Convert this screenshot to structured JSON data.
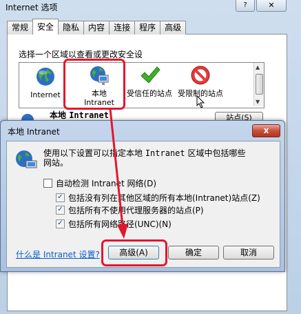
{
  "outer": {
    "title": "Internet 选项",
    "help_label": "?",
    "close_label": "✕",
    "tabs": [
      {
        "label": "常规"
      },
      {
        "label": "安全"
      },
      {
        "label": "隐私"
      },
      {
        "label": "内容"
      },
      {
        "label": "连接"
      },
      {
        "label": "程序"
      },
      {
        "label": "高级"
      }
    ],
    "zone_prompt": "选择一个区域以查看或更改安全设",
    "zones": [
      {
        "label": "Internet",
        "icon": "globe-icon"
      },
      {
        "label_line1": "本地",
        "label_line2": "Intranet",
        "icon": "intranet-icon"
      },
      {
        "label": "受信任的站点",
        "icon": "check-icon"
      },
      {
        "label": "受限制的站点",
        "icon": "restricted-icon"
      }
    ],
    "zone_heading_cn": "本地 ",
    "zone_heading_en": "Intranet",
    "sites_button": "站点(S)"
  },
  "inner": {
    "title": "本地 Intranet",
    "close_label": "x",
    "description_pre": "使用以下设置可以指定本地 ",
    "description_mono": "Intranet",
    "description_post": " 区域中包括哪些网站。",
    "options": [
      {
        "label": "自动检测 Intranet 网络(D)",
        "checked": false
      },
      {
        "label": "包括没有列在其他区域的所有本地(Intranet)站点(Z)",
        "checked": true
      },
      {
        "label": "包括所有不使用代理服务器的站点(P)",
        "checked": true
      },
      {
        "label": "包括所有网络路径(UNC)(N)",
        "checked": true
      }
    ],
    "help_link": "什么是 Intranet 设置?",
    "advanced_button": "高级(A)",
    "ok_button": "确定",
    "cancel_button": "取消"
  },
  "colors": {
    "highlight": "#e2162d",
    "link": "#0b5dc9"
  }
}
